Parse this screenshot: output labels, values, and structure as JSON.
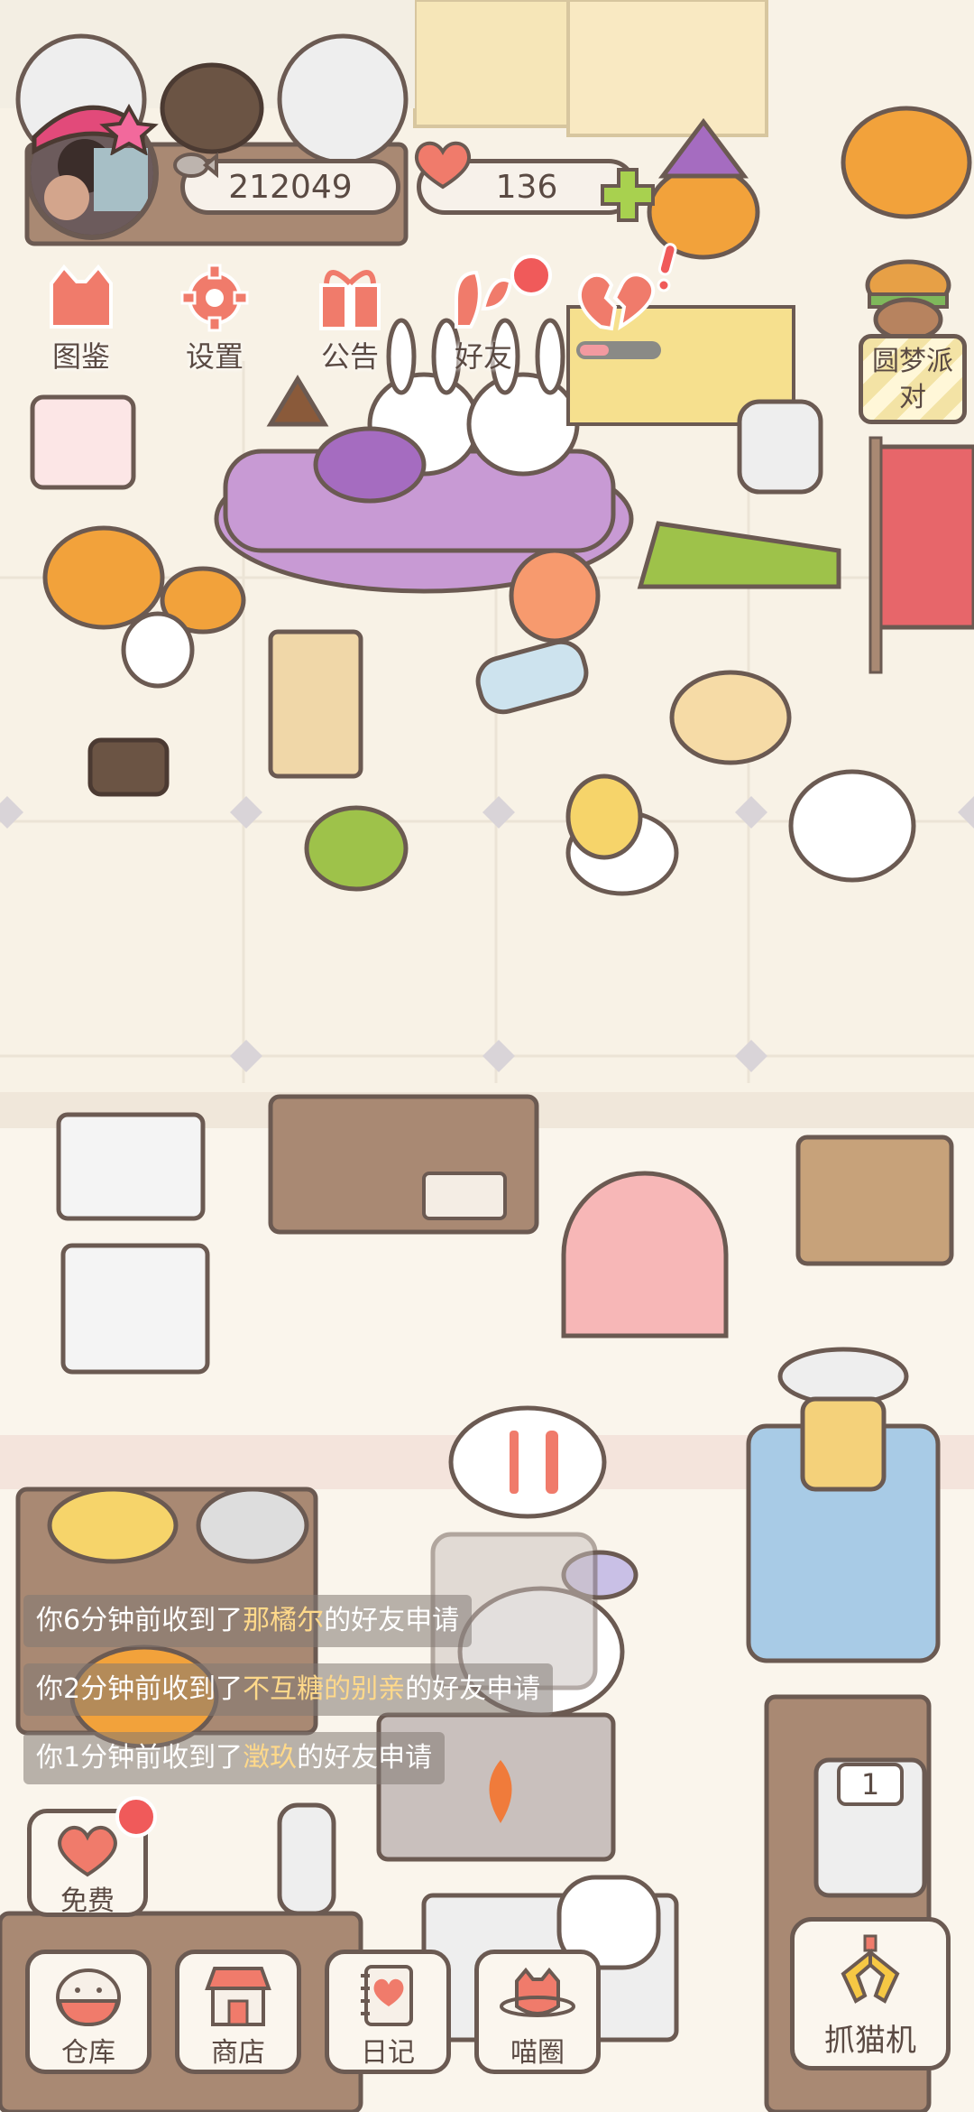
{
  "player": {
    "coins": "212049",
    "hearts": "136"
  },
  "menu": {
    "collection": "图鉴",
    "settings": "设置",
    "announcement": "公告",
    "friends": "好友"
  },
  "event_button": {
    "line1": "圆梦派",
    "line2": "对"
  },
  "notifications": [
    {
      "prefix": "你6分钟前收到了",
      "name": "那橘尔",
      "suffix": "的好友申请"
    },
    {
      "prefix": "你2分钟前收到了",
      "name": "不互糖的别亲",
      "suffix": "的好友申请"
    },
    {
      "prefix": "你1分钟前收到了",
      "name": "澂玖",
      "suffix": "的好友申请"
    }
  ],
  "free_button": "免费",
  "bottom_nav": {
    "warehouse": "仓库",
    "shop": "商店",
    "diary": "日记",
    "meow_circle": "喵圈"
  },
  "claw_machine": "抓猫机",
  "slot_counter": "1",
  "colors": {
    "background": "#f8f2e6",
    "outline": "#6b5a52",
    "accent_pink": "#f07b6b",
    "badge_red": "#f05a5a",
    "highlight_name": "#ffd98a"
  }
}
